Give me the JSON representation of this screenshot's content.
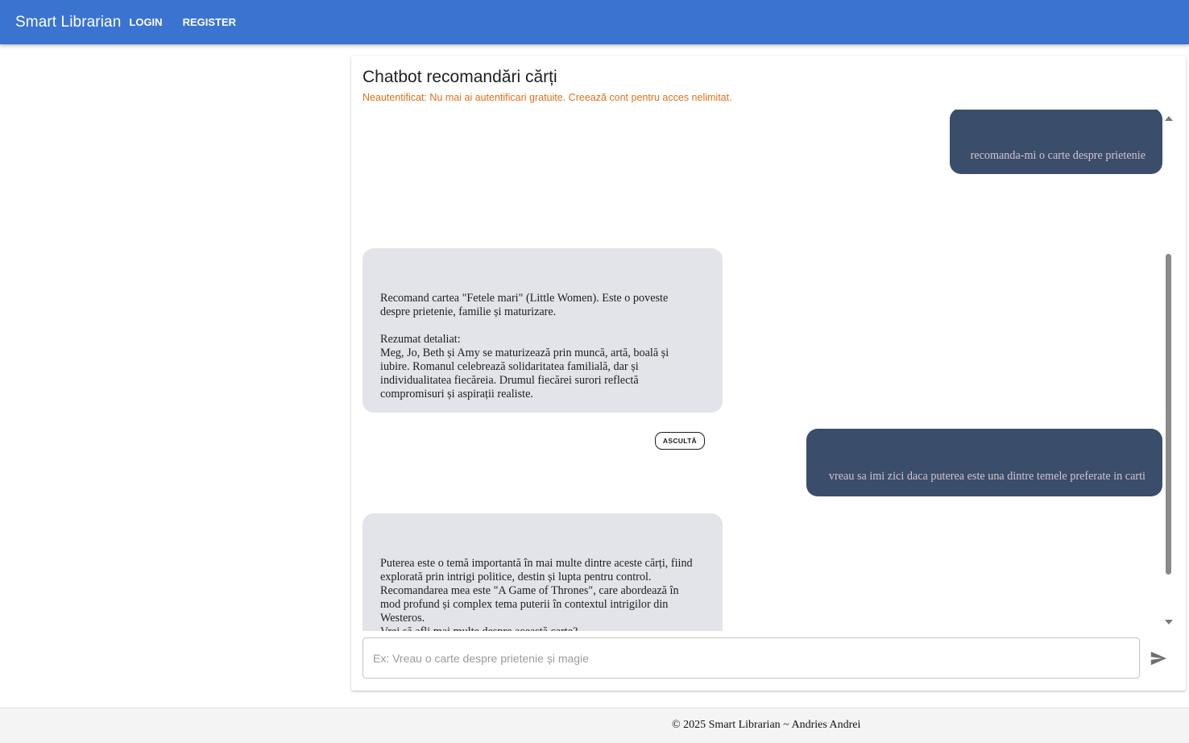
{
  "header": {
    "brand": "Smart Librarian",
    "nav": [
      {
        "label": "LOGIN"
      },
      {
        "label": "REGISTER"
      }
    ]
  },
  "chat": {
    "title": "Chatbot recomandări cărți",
    "warning": "Neautentificat: Nu mai ai autentificari gratuite. Creează cont pentru acces nelimitat.",
    "listen_label": "ASCULTĂ",
    "messages": [
      {
        "role": "user",
        "text": "recomanda-mi o carte despre prietenie"
      },
      {
        "role": "bot",
        "text": "Recomand cartea \"Fetele mari\" (Little Women). Este o poveste\ndespre prietenie, familie și maturizare.\n\nRezumat detaliat:\nMeg, Jo, Beth și Amy se maturizează prin muncă, artă, boală și\niubire. Romanul celebrează solidaritatea familială, dar și\nindividualitatea fiecăreia. Drumul fiecărei surori reflectă\ncompromisuri și aspirații realiste."
      },
      {
        "role": "user",
        "text": "vreau sa imi zici daca puterea este una dintre temele preferate in carti"
      },
      {
        "role": "bot",
        "text": "Puterea este o temă importantă în mai multe dintre aceste cărți, fiind\nexplorată prin intrigi politice, destin și lupta pentru control.\nRecomandarea mea este \"A Game of Thrones\", care abordează în\nmod profund și complex tema puterii în contextul intrigilor din\nWesteros.\nVrei să afli mai multe despre această carte?\n\nRezumat detaliat:\nKvothe își narează viața: copil actor, orfan, student la Universitate,\nmuzician și viitor arcanist. Dorința de cunoaștere și dorul de adevăr\ndespre misterioșii Chandrian îl împing să încalce reguli și să riște\ntotul. Romanul alternează lirismul cu detaliile lumii magice, punând"
      }
    ]
  },
  "input": {
    "placeholder": "Ex: Vreau o carte despre prietenie și magie",
    "value": ""
  },
  "footer": {
    "text": "© 2025 Smart Librarian ~ Andries Andrei"
  },
  "icons": {
    "send": "send-icon",
    "scroll_up": "chevron-up-icon",
    "scroll_down": "chevron-down-icon"
  },
  "colors": {
    "appbar": "#3a74d0",
    "user_bubble": "#3a4d6b",
    "bot_bubble": "#e3e4e9",
    "warning": "#e0701c"
  }
}
